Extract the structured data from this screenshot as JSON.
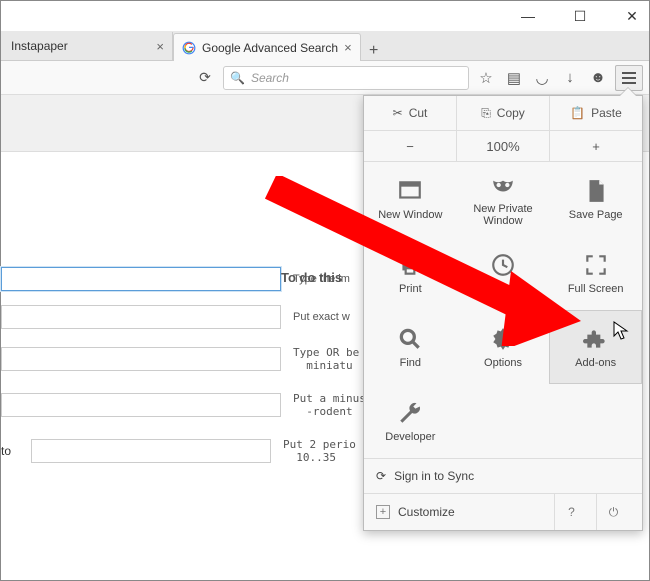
{
  "window": {
    "minimize": "—",
    "maximize": "☐",
    "close": "✕"
  },
  "tabs": [
    {
      "title": "Instapaper",
      "active": false
    },
    {
      "title": "Google Advanced Search",
      "active": true
    }
  ],
  "toolbar": {
    "search_placeholder": "Search"
  },
  "menu": {
    "clipboard": {
      "cut": "Cut",
      "copy": "Copy",
      "paste": "Paste"
    },
    "zoom": {
      "minus": "−",
      "level": "100%",
      "plus": "+"
    },
    "items": [
      {
        "label": "New Window"
      },
      {
        "label": "New Private Window"
      },
      {
        "label": "Save Page"
      },
      {
        "label": "Print"
      },
      {
        "label": "History"
      },
      {
        "label": "Full Screen"
      },
      {
        "label": "Find"
      },
      {
        "label": "Options"
      },
      {
        "label": "Add-ons"
      },
      {
        "label": "Developer"
      }
    ],
    "signin": "Sign in to Sync",
    "customize": "Customize"
  },
  "page": {
    "heading": "To do this",
    "rows": [
      {
        "hint": "Type the im"
      },
      {
        "hint": "Put exact w"
      },
      {
        "hint": "Type OR be\n  miniatu"
      },
      {
        "hint": "Put a minus\n  -rodent"
      },
      {
        "hint": "Put 2 perio\n  10..35"
      }
    ],
    "to_label": "to"
  }
}
